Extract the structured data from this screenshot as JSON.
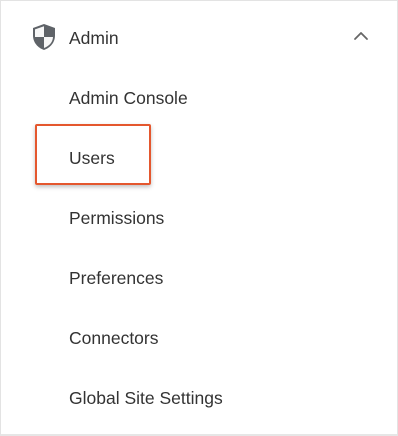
{
  "section": {
    "title": "Admin",
    "icon": "shield-icon",
    "expanded": true,
    "toggle_icon": "chevron-up-icon"
  },
  "menu": {
    "items": [
      {
        "label": "Admin Console"
      },
      {
        "label": "Users"
      },
      {
        "label": "Permissions"
      },
      {
        "label": "Preferences"
      },
      {
        "label": "Connectors"
      },
      {
        "label": "Global Site Settings"
      }
    ]
  },
  "highlight": {
    "target": "Users",
    "color": "#e4572e"
  },
  "colors": {
    "text": "#333333",
    "icon": "#5f6368",
    "border": "#e3e3e3"
  }
}
